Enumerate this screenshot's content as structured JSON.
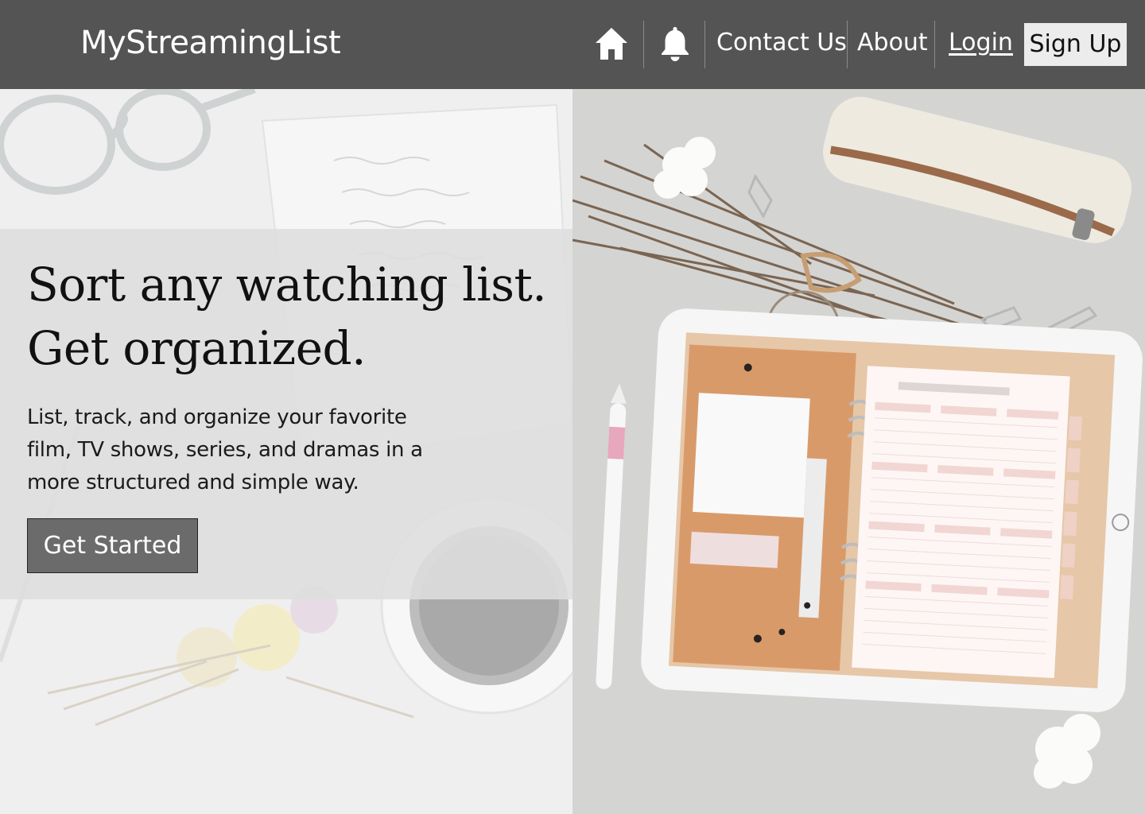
{
  "nav": {
    "brand": "MyStreamingList",
    "home_icon": "home-icon",
    "bell_icon": "bell-icon",
    "contact": "Contact Us",
    "about": "About",
    "login": "Login",
    "signup": "Sign Up"
  },
  "hero": {
    "title_line1": "Sort any watching list.",
    "title_line2": "Get organized.",
    "description": "List, track, and organize your favorite film, TV shows, series, and dramas in a more structured and simple way.",
    "cta": "Get Started"
  },
  "colors": {
    "navbar": "#545454",
    "signup_bg": "#ececec",
    "cta_bg": "#6b6b6b"
  }
}
